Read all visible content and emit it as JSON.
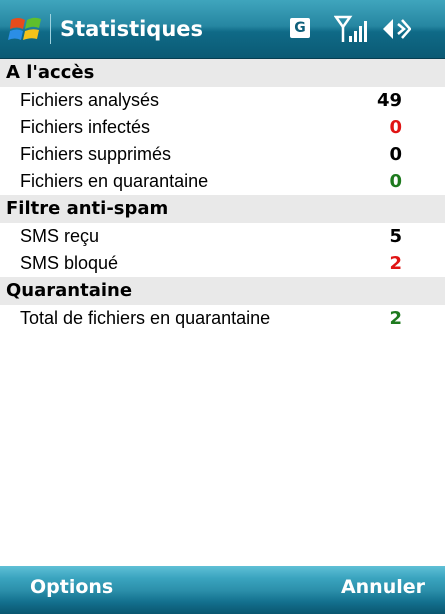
{
  "title_bar": {
    "title": "Statistiques",
    "network_badge": "G",
    "icons": [
      "windows-start-icon",
      "signal-icon",
      "volume-icon"
    ]
  },
  "sections": [
    {
      "header": "A l'accès",
      "rows": [
        {
          "label": "Fichiers analysés",
          "value": "49",
          "color": "#000000"
        },
        {
          "label": "Fichiers infectés",
          "value": "0",
          "color": "#e01414"
        },
        {
          "label": "Fichiers supprimés",
          "value": "0",
          "color": "#000000"
        },
        {
          "label": "Fichiers en quarantaine",
          "value": "0",
          "color": "#1e7a1e"
        }
      ]
    },
    {
      "header": "Filtre anti-spam",
      "rows": [
        {
          "label": "SMS reçu",
          "value": "5",
          "color": "#000000"
        },
        {
          "label": "SMS bloqué",
          "value": "2",
          "color": "#e01414"
        }
      ]
    },
    {
      "header": "Quarantaine",
      "rows": [
        {
          "label": "Total de fichiers en quarantaine",
          "value": "2",
          "color": "#1e7a1e"
        }
      ]
    }
  ],
  "softkeys": {
    "left": "Options",
    "right": "Annuler"
  }
}
